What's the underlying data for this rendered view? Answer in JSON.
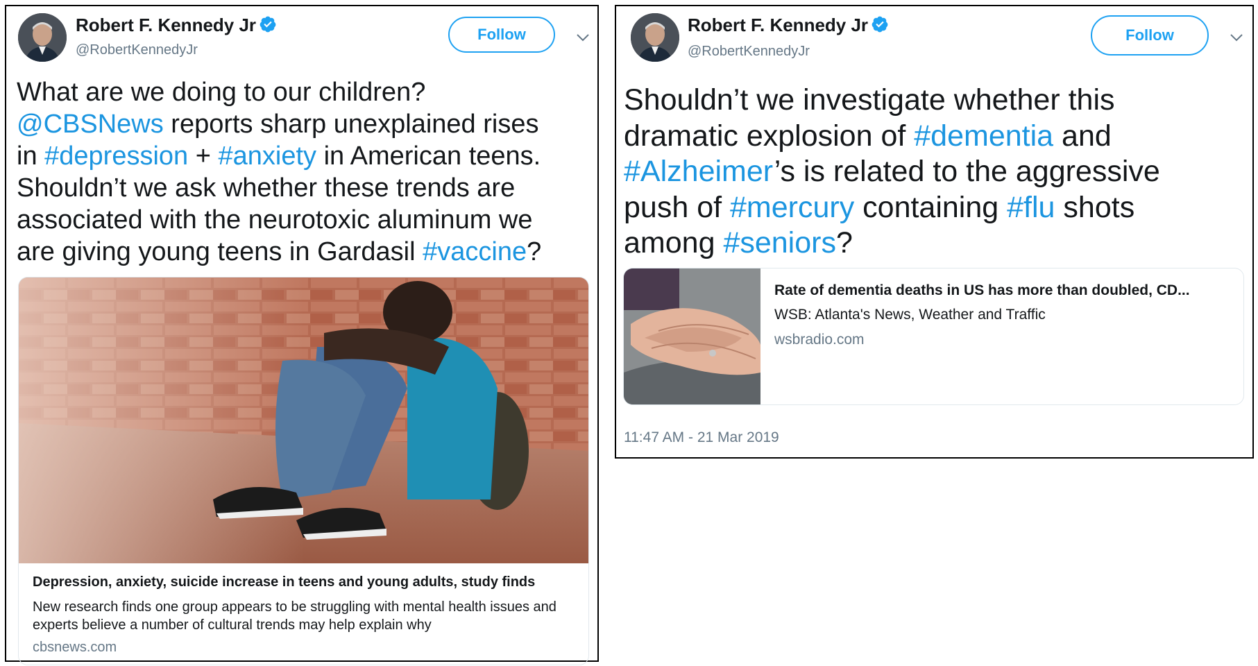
{
  "tweets": [
    {
      "author": {
        "name": "Robert F. Kennedy Jr",
        "handle": "@RobertKennedyJr",
        "verified": true
      },
      "follow_label": "Follow",
      "text_lines": [
        [
          {
            "t": "What are we doing to our children?",
            "link": false
          }
        ],
        [
          {
            "t": "@CBSNews",
            "link": true
          },
          {
            "t": " reports sharp unexplained rises",
            "link": false
          }
        ],
        [
          {
            "t": "in ",
            "link": false
          },
          {
            "t": "#depression",
            "link": true
          },
          {
            "t": " + ",
            "link": false
          },
          {
            "t": "#anxiety",
            "link": true
          },
          {
            "t": " in American teens.",
            "link": false
          }
        ],
        [
          {
            "t": "Shouldn’t we ask whether these trends are",
            "link": false
          }
        ],
        [
          {
            "t": "associated with the neurotoxic aluminum we",
            "link": false
          }
        ],
        [
          {
            "t": "are giving young teens in Gardasil ",
            "link": false
          },
          {
            "t": "#vaccine",
            "link": true
          },
          {
            "t": "?",
            "link": false
          }
        ]
      ],
      "card": {
        "image_icon": "sad-boy-against-brick-wall-photo",
        "title": "Depression, anxiety, suicide increase in teens and young adults, study finds",
        "description": "New research finds one group appears to be struggling with mental health issues and experts believe a number of cultural trends may help explain why",
        "domain": "cbsnews.com"
      }
    },
    {
      "author": {
        "name": "Robert F. Kennedy Jr",
        "handle": "@RobertKennedyJr",
        "verified": true
      },
      "follow_label": "Follow",
      "text_lines": [
        [
          {
            "t": "Shouldn’t we investigate whether this",
            "link": false
          }
        ],
        [
          {
            "t": "dramatic explosion of ",
            "link": false
          },
          {
            "t": "#dementia",
            "link": true
          },
          {
            "t": " and",
            "link": false
          }
        ],
        [
          {
            "t": "#Alzheimer",
            "link": true
          },
          {
            "t": "’s is related to the aggressive",
            "link": false
          }
        ],
        [
          {
            "t": "push of ",
            "link": false
          },
          {
            "t": "#mercury",
            "link": true
          },
          {
            "t": " containing ",
            "link": false
          },
          {
            "t": "#flu",
            "link": true
          },
          {
            "t": " shots",
            "link": false
          }
        ],
        [
          {
            "t": "among ",
            "link": false
          },
          {
            "t": "#seniors",
            "link": true
          },
          {
            "t": "?",
            "link": false
          }
        ]
      ],
      "card": {
        "image_icon": "elderly-hands-photo",
        "title": "Rate of dementia deaths in US has more than doubled, CD...",
        "description": "WSB: Atlanta's News, Weather and Traffic",
        "domain": "wsbradio.com"
      },
      "timestamp": "11:47 AM - 21 Mar 2019"
    }
  ],
  "colors": {
    "link": "#1b95e0",
    "follow": "#1da1f2",
    "muted": "#657786",
    "text": "#14171a"
  }
}
